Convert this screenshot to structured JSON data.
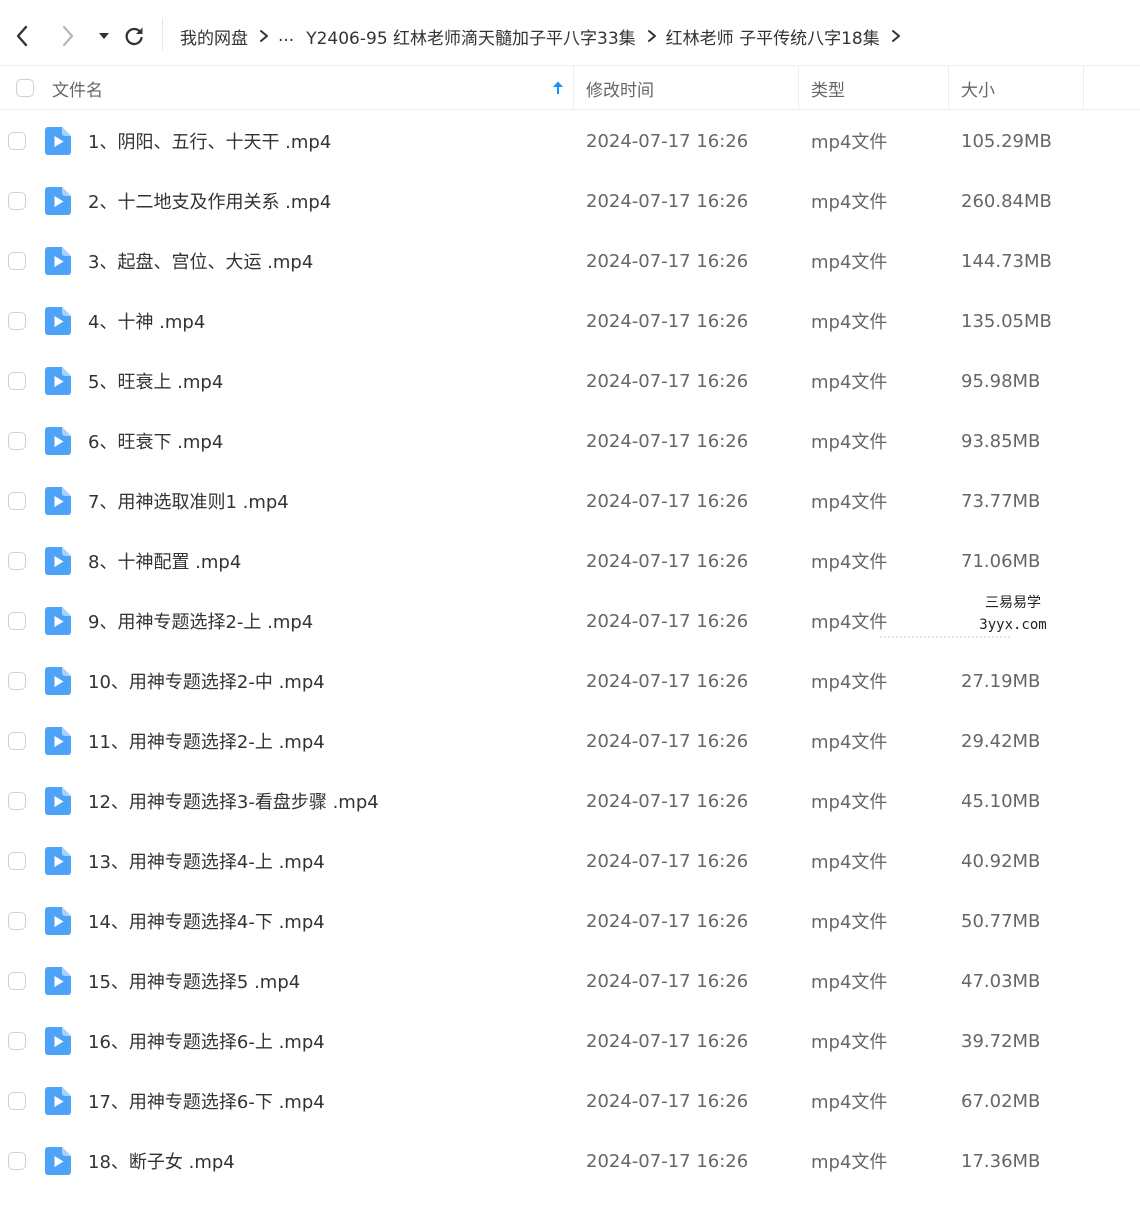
{
  "toolbar": {
    "breadcrumb": {
      "root": "我的网盘",
      "ellipsis": "...",
      "folder1": "Y2406-95 红林老师滴天髓加子平八字33集",
      "folder2": "红林老师 子平传统八字18集"
    }
  },
  "columns": {
    "name": "文件名",
    "modified": "修改时间",
    "type": "类型",
    "size": "大小"
  },
  "files": [
    {
      "name": "1、阴阳、五行、十天干 .mp4",
      "modified": "2024-07-17 16:26",
      "type": "mp4文件",
      "size": "105.29MB"
    },
    {
      "name": "2、十二地支及作用关系 .mp4",
      "modified": "2024-07-17 16:26",
      "type": "mp4文件",
      "size": "260.84MB"
    },
    {
      "name": "3、起盘、宫位、大运 .mp4",
      "modified": "2024-07-17 16:26",
      "type": "mp4文件",
      "size": "144.73MB"
    },
    {
      "name": "4、十神 .mp4",
      "modified": "2024-07-17 16:26",
      "type": "mp4文件",
      "size": "135.05MB"
    },
    {
      "name": "5、旺衰上 .mp4",
      "modified": "2024-07-17 16:26",
      "type": "mp4文件",
      "size": "95.98MB"
    },
    {
      "name": "6、旺衰下 .mp4",
      "modified": "2024-07-17 16:26",
      "type": "mp4文件",
      "size": "93.85MB"
    },
    {
      "name": "7、用神选取准则1 .mp4",
      "modified": "2024-07-17 16:26",
      "type": "mp4文件",
      "size": "73.77MB"
    },
    {
      "name": "8、十神配置 .mp4",
      "modified": "2024-07-17 16:26",
      "type": "mp4文件",
      "size": "71.06MB"
    },
    {
      "name": "9、用神专题选择2-上 .mp4",
      "modified": "2024-07-17 16:26",
      "type": "mp4文件",
      "size": ""
    },
    {
      "name": "10、用神专题选择2-中 .mp4",
      "modified": "2024-07-17 16:26",
      "type": "mp4文件",
      "size": "27.19MB"
    },
    {
      "name": "11、用神专题选择2-上 .mp4",
      "modified": "2024-07-17 16:26",
      "type": "mp4文件",
      "size": "29.42MB"
    },
    {
      "name": "12、用神专题选择3-看盘步骤 .mp4",
      "modified": "2024-07-17 16:26",
      "type": "mp4文件",
      "size": "45.10MB"
    },
    {
      "name": "13、用神专题选择4-上 .mp4",
      "modified": "2024-07-17 16:26",
      "type": "mp4文件",
      "size": "40.92MB"
    },
    {
      "name": "14、用神专题选择4-下 .mp4",
      "modified": "2024-07-17 16:26",
      "type": "mp4文件",
      "size": "50.77MB"
    },
    {
      "name": "15、用神专题选择5 .mp4",
      "modified": "2024-07-17 16:26",
      "type": "mp4文件",
      "size": "47.03MB"
    },
    {
      "name": "16、用神专题选择6-上 .mp4",
      "modified": "2024-07-17 16:26",
      "type": "mp4文件",
      "size": "39.72MB"
    },
    {
      "name": "17、用神专题选择6-下 .mp4",
      "modified": "2024-07-17 16:26",
      "type": "mp4文件",
      "size": "67.02MB"
    },
    {
      "name": "18、断子女 .mp4",
      "modified": "2024-07-17 16:26",
      "type": "mp4文件",
      "size": "17.36MB"
    }
  ],
  "watermark": {
    "line1": "三易易学",
    "line2": "3yyx.com"
  },
  "icons": {
    "video_file": "video-file-icon",
    "back": "back-arrow-icon",
    "forward": "forward-arrow-icon",
    "dropdown": "dropdown-caret-icon",
    "refresh": "refresh-icon",
    "sort": "sort-ascending-icon"
  },
  "colors": {
    "accent_blue": "#4DA3F7",
    "sort_arrow": "#1890ff",
    "text": "#333333",
    "muted_text": "#666666",
    "border": "#eeeeee"
  }
}
